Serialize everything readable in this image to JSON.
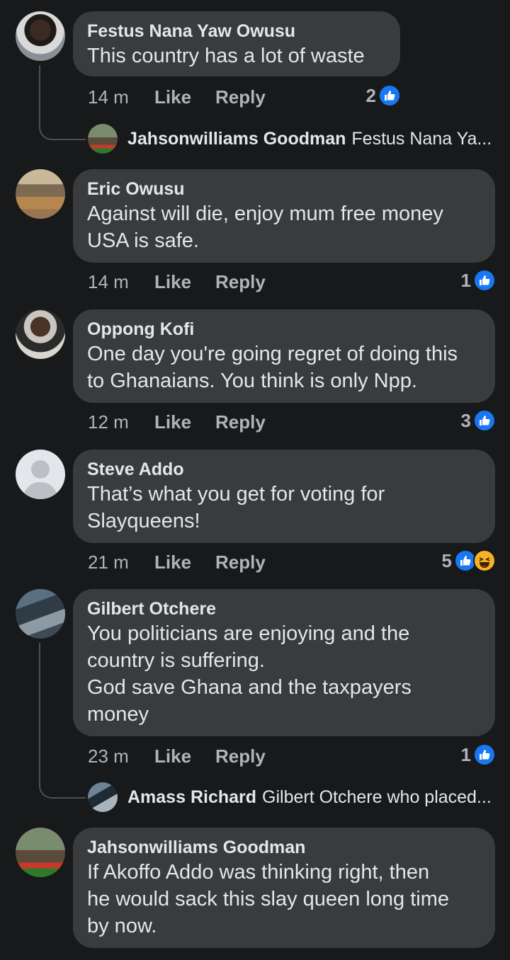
{
  "colors": {
    "background": "#18191a",
    "bubble": "#3a3b3c",
    "secondary_text": "#b0b3b8",
    "like_blue": "#1877f2",
    "haha_yellow": "#f7b125"
  },
  "comments": [
    {
      "name": "Festus Nana Yaw Owusu",
      "text": "This country has a lot of waste",
      "time": "14 m",
      "like_label": "Like",
      "reply_label": "Reply",
      "reaction_count": "2",
      "reactions": [
        "like-icon"
      ],
      "reply_preview": {
        "name": "Jahsonwilliams Goodman",
        "text": "Festus Nana Ya..."
      }
    },
    {
      "name": "Eric Owusu",
      "text": "Against will die, enjoy mum  free money\nUSA is safe.",
      "time": "14 m",
      "like_label": "Like",
      "reply_label": "Reply",
      "reaction_count": "1",
      "reactions": [
        "like-icon"
      ]
    },
    {
      "name": "Oppong Kofi",
      "text": "One day you're going regret of doing this\nto Ghanaians. You think is only Npp.",
      "time": "12 m",
      "like_label": "Like",
      "reply_label": "Reply",
      "reaction_count": "3",
      "reactions": [
        "like-icon"
      ]
    },
    {
      "name": "Steve Addo",
      "text": "That’s what you get for voting for\nSlayqueens!",
      "time": "21 m",
      "like_label": "Like",
      "reply_label": "Reply",
      "reaction_count": "5",
      "reactions": [
        "like-icon",
        "haha-icon"
      ]
    },
    {
      "name": "Gilbert Otchere",
      "text": "You politicians are enjoying and the\ncountry is suffering.\nGod save Ghana and the taxpayers\nmoney",
      "time": "23 m",
      "like_label": "Like",
      "reply_label": "Reply",
      "reaction_count": "1",
      "reactions": [
        "like-icon"
      ],
      "reply_preview": {
        "name": "Amass Richard",
        "text": "Gilbert Otchere who placed..."
      }
    },
    {
      "name": "Jahsonwilliams Goodman",
      "text": "If Akoffo Addo was thinking right, then\nhe would sack this slay queen long time\nby now."
    }
  ]
}
